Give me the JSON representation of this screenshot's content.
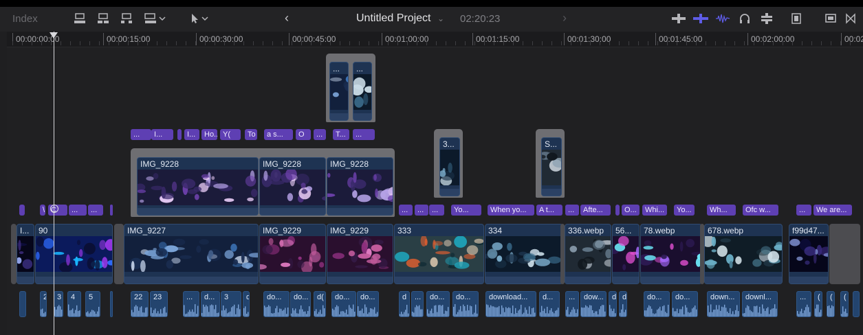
{
  "toolbar": {
    "index_label": "Index",
    "project_title": "Untitled Project",
    "duration": "02:20:23",
    "icons": [
      "append-clip-icon",
      "insert-clip-icon",
      "overwrite-clip-icon",
      "connect-clip-icon",
      "arrow-tool-icon",
      "back-icon",
      "forward-icon",
      "zoom-audio-icon",
      "snapping-icon",
      "audio-skimming-icon",
      "headphones-icon",
      "solo-icon",
      "clip-appearance-icon",
      "inspector-icon",
      "filmstrip-icon"
    ]
  },
  "ruler": {
    "timecodes": [
      "00:00:00:00",
      "00:00:15:00",
      "00:00:30:00",
      "00:00:45:00",
      "00:01:00:00",
      "00:01:15:00",
      "00:01:30:00",
      "00:01:45:00",
      "00:02:00:00",
      "00:02:"
    ]
  },
  "connected_top": [
    {
      "label": "..."
    },
    {
      "label": "..."
    }
  ],
  "connected_small": [
    {
      "label": "3..."
    },
    {
      "label": "S..."
    }
  ],
  "title_row1": [
    "...",
    "I...",
    "...",
    "I...",
    "Ho...",
    "Y(",
    "To I...",
    "a s...",
    "O",
    "...",
    "T...",
    "..."
  ],
  "secondary_story": [
    {
      "name": "IMG_9228"
    },
    {
      "name": "IMG_9228"
    },
    {
      "name": "IMG_9228"
    }
  ],
  "title_row2": [
    "\\",
    "C",
    "...",
    "...",
    "...",
    "...",
    "...",
    "Yo...",
    "When yo...",
    "A t...",
    "...",
    "Afte...",
    "O...",
    "Whi...",
    "Yo...",
    "Wh...",
    "Ofc w...",
    "...",
    "We are..."
  ],
  "primary": [
    {
      "name": "I..."
    },
    {
      "name": "90"
    },
    {
      "name": "IMG_9227"
    },
    {
      "name": "IMG_9229"
    },
    {
      "name": "IMG_9229"
    },
    {
      "name": "333"
    },
    {
      "name": "334"
    },
    {
      "name": "336.webp"
    },
    {
      "name": "56..."
    },
    {
      "name": "78.webp"
    },
    {
      "name": "678.webp"
    },
    {
      "name": "f99d47..."
    }
  ],
  "audio": [
    "2",
    "3",
    "4",
    "5",
    "22",
    "23",
    "...",
    "d...",
    "3",
    "d(",
    "do...",
    "do...",
    "d(",
    "do...",
    "do...",
    "d",
    "...",
    "do...",
    "do...",
    "download...",
    "d...",
    "...",
    "dow...",
    "d",
    "d",
    "do...",
    "do...",
    "down...",
    "downl...",
    "...",
    "(",
    "(",
    "("
  ],
  "colors": {
    "accent": "#5e5ce6",
    "video": "#1e3352",
    "title": "#5e3fb3",
    "audio": "#23446e"
  }
}
